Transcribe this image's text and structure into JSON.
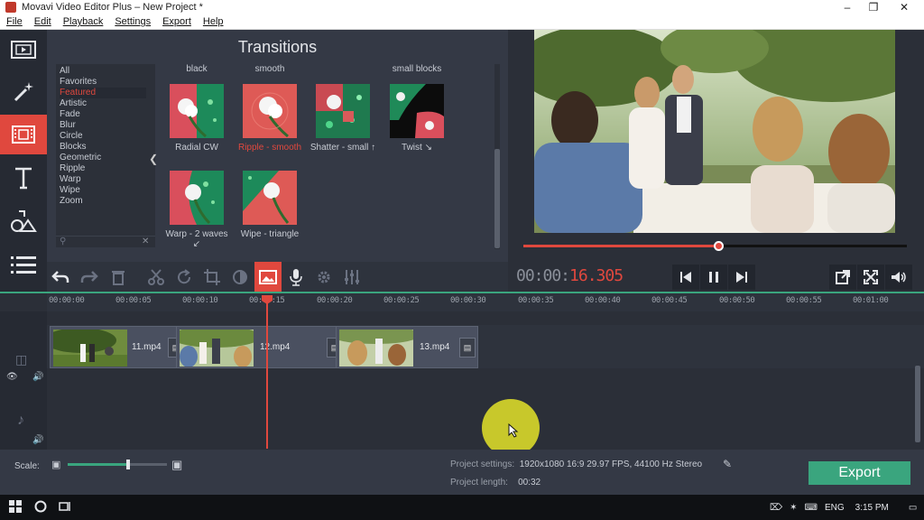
{
  "window": {
    "title": "Movavi Video Editor Plus – New Project *",
    "controls": [
      "minimize-icon",
      "maximize-icon",
      "close-icon"
    ]
  },
  "menu": [
    "File",
    "Edit",
    "Playback",
    "Settings",
    "Export",
    "Help"
  ],
  "left_tools": [
    {
      "icon": "film-icon",
      "active": false
    },
    {
      "icon": "magic-wand-icon",
      "active": false
    },
    {
      "icon": "transitions-icon",
      "active": true
    },
    {
      "icon": "titles-icon",
      "active": false
    },
    {
      "icon": "shapes-icon",
      "active": false
    },
    {
      "icon": "list-icon",
      "active": false
    }
  ],
  "transitions": {
    "title": "Transitions",
    "categories": [
      "All",
      "Favorites",
      "Featured",
      "Artistic",
      "Fade",
      "Blur",
      "Circle",
      "Blocks",
      "Geometric",
      "Ripple",
      "Warp",
      "Wipe",
      "Zoom"
    ],
    "selected_category": "Featured",
    "group_headers": [
      "black",
      "smooth",
      "",
      "small blocks"
    ],
    "items": [
      {
        "name": "Radial CW"
      },
      {
        "name": "Ripple - smooth",
        "selected": true
      },
      {
        "name": "Shatter - small ↑"
      },
      {
        "name": "Twist ↘"
      },
      {
        "name": "Warp - 2 waves ↙"
      },
      {
        "name": "Wipe - triangle"
      }
    ]
  },
  "preview": {
    "timecode_main": "00:00:",
    "timecode_ms": "16.305",
    "progress": 0.51,
    "buttons": [
      "skip-back-icon",
      "pause-icon",
      "skip-forward-icon",
      "popout-icon",
      "fullscreen-icon",
      "volume-icon"
    ]
  },
  "edit_tools": [
    "undo-icon",
    "redo-icon",
    "delete-icon",
    "cut-icon",
    "rotate-icon",
    "crop-icon",
    "color-adjust-icon",
    "image-icon",
    "microphone-icon",
    "gear-icon",
    "equalizer-icon"
  ],
  "timeline": {
    "ticks": [
      "00:00:00",
      "00:00:05",
      "00:00:10",
      "00:00:15",
      "00:00:20",
      "00:00:25",
      "00:00:30",
      "00:00:35",
      "00:00:40",
      "00:00:45",
      "00:00:50",
      "00:00:55",
      "00:01:00"
    ],
    "clips": [
      {
        "name": "11.mp4"
      },
      {
        "name": "12.mp4"
      },
      {
        "name": "13.mp4"
      }
    ]
  },
  "bottom": {
    "scale_label": "Scale:",
    "project_settings_label": "Project settings:",
    "project_settings_value": "1920x1080 16:9 29.97 FPS, 44100 Hz Stereo",
    "project_length_label": "Project length:",
    "project_length_value": "00:32",
    "export_label": "Export",
    "scale_level": 0.6
  },
  "taskbar": {
    "lang": "ENG",
    "time": "3:15 PM"
  },
  "colors": {
    "accent": "#e0483e",
    "export": "#3aa57e",
    "panel": "#343945"
  }
}
